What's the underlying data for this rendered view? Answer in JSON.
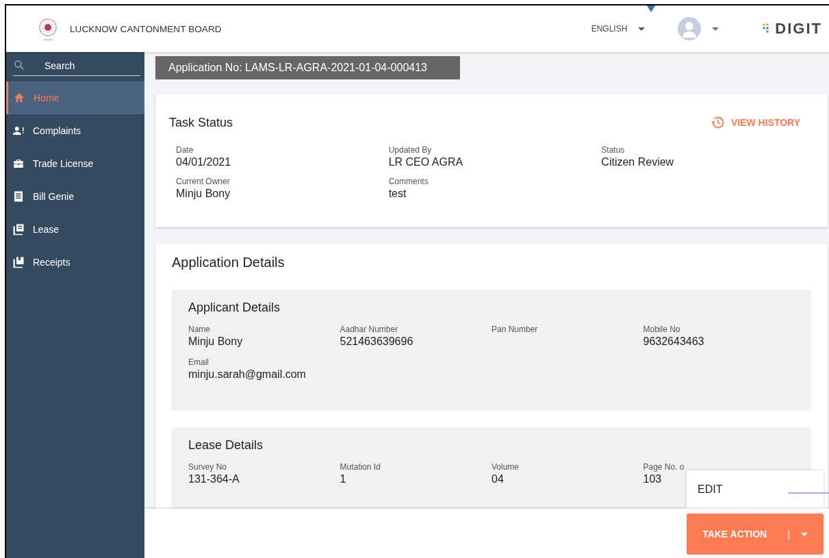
{
  "header": {
    "title": "LUCKNOW CANTONMENT BOARD",
    "language": "ENGLISH",
    "brand": "DIGIT"
  },
  "sidebar": {
    "search": {
      "placeholder": "Search"
    },
    "items": [
      {
        "label": "Home",
        "selected": true
      },
      {
        "label": "Complaints",
        "selected": false
      },
      {
        "label": "Trade License",
        "selected": false
      },
      {
        "label": "Bill Genie",
        "selected": false
      },
      {
        "label": "Lease",
        "selected": false
      },
      {
        "label": "Receipts",
        "selected": false
      }
    ]
  },
  "application_no": "Application No: LAMS-LR-AGRA-2021-01-04-000413",
  "task_status": {
    "title": "Task Status",
    "history_button": "VIEW HISTORY",
    "fields": [
      {
        "label": "Date",
        "value": "04/01/2021"
      },
      {
        "label": "Updated By",
        "value": "LR CEO AGRA"
      },
      {
        "label": "Status",
        "value": "Citizen Review"
      },
      {
        "label": "Current Owner",
        "value": "Minju Bony"
      },
      {
        "label": "Comments",
        "value": "test"
      }
    ]
  },
  "application_details": {
    "title": "Application Details",
    "sections": [
      {
        "title": "Applicant Details",
        "fields": [
          {
            "label": "Name",
            "value": "Minju Bony"
          },
          {
            "label": "Aadhar Number",
            "value": "521463639696"
          },
          {
            "label": "Pan Number"
          },
          {
            "label": "Mobile No",
            "value": "9632643463"
          },
          {
            "label": "Email",
            "value": "minju.sarah@gmail.com"
          }
        ]
      },
      {
        "title": "Lease Details",
        "fields": [
          {
            "label": "Survey No",
            "value": "131-364-A"
          },
          {
            "label": "Mutation Id",
            "value": "1"
          },
          {
            "label": "Volume",
            "value": "04"
          },
          {
            "label": "Page No. o",
            "value": "103"
          }
        ]
      }
    ]
  },
  "action_menu": {
    "items": [
      "EDIT"
    ]
  },
  "take_action": {
    "label": "TAKE ACTION",
    "separator": "|"
  }
}
